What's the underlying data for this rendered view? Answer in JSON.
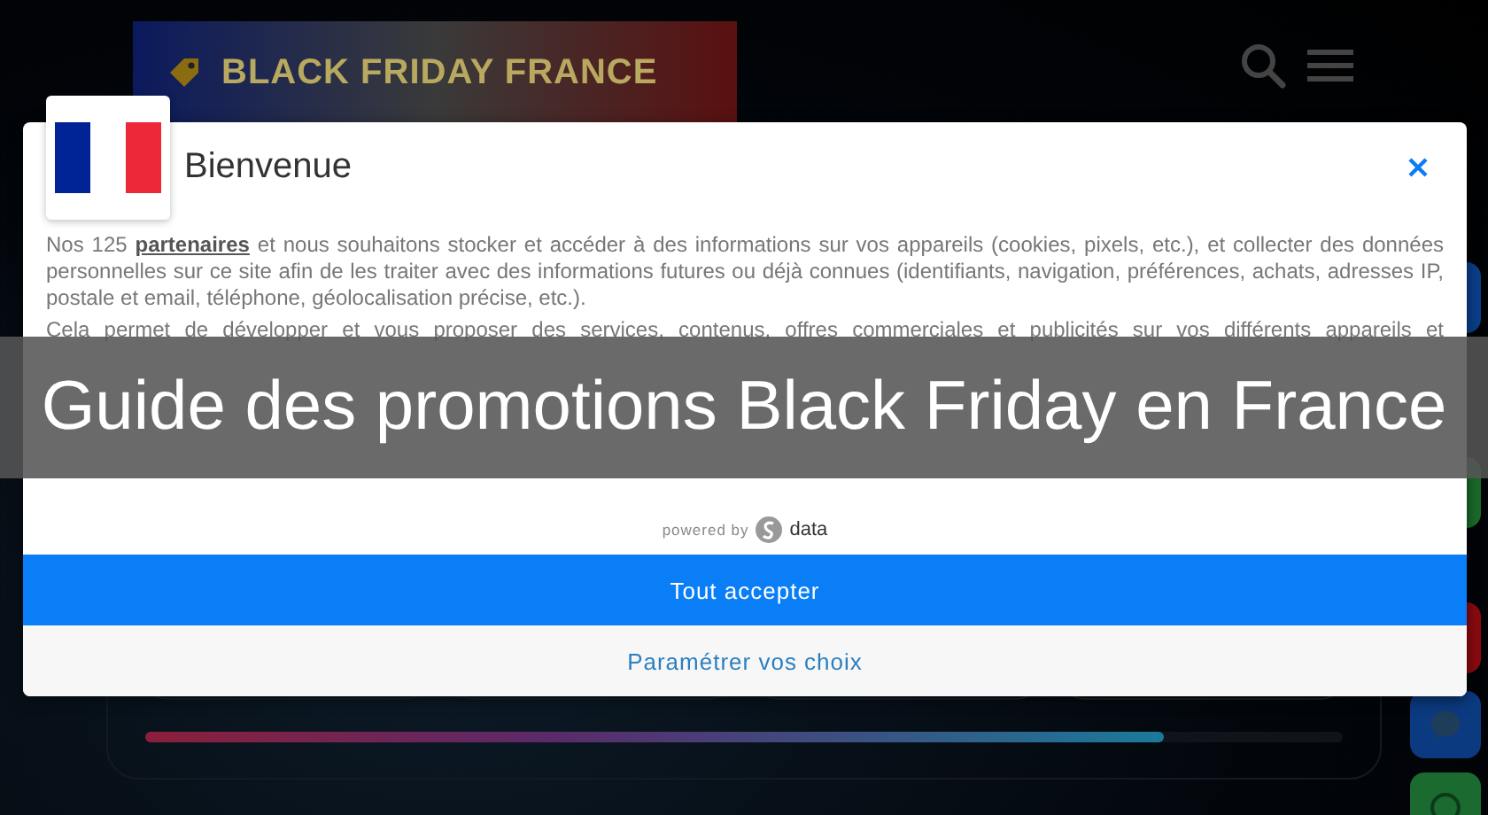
{
  "header": {
    "logo": "BLACK FRIDAY FRANCE"
  },
  "consent": {
    "title": "Bienvenue",
    "intro": {
      "before": "Nos 125 ",
      "link": "partenaires",
      "after": " et nous souhaitons stocker et accéder à des informations sur vos appareils (cookies, pixels, etc.), et collecter des données personnelles sur ce site afin de les traiter avec des informations futures ou déjà connues (identifiants, navigation, préférences, achats, adresses IP, postale et email, téléphone, géolocalisation précise, etc.)."
    },
    "paragraphs": [
      "Cela permet de développer et vous proposer des services, contenus, offres commerciales et publicités sur vos différents appareils et"
    ],
    "powered_by": "powered by",
    "brand": "data",
    "buttons": [
      {
        "label": "Tout accepter",
        "kind": "primary"
      },
      {
        "label": "Paramétrer vos choix",
        "kind": "secondary"
      }
    ]
  },
  "banner": {
    "title": "Guide des promotions Black Friday en France"
  },
  "progress": {
    "level": 0.85
  }
}
